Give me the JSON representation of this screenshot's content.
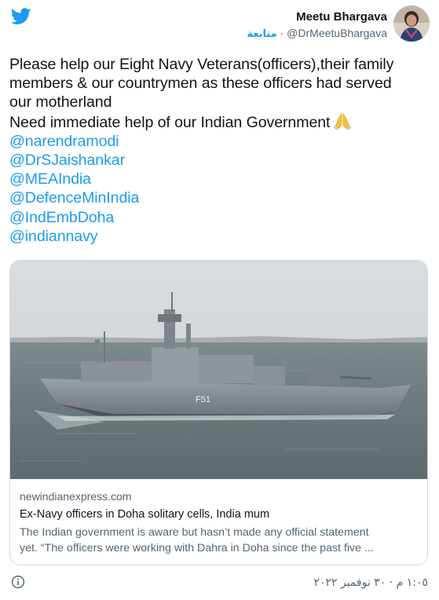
{
  "header": {
    "brand_icon": "twitter-bird-icon",
    "display_name": "Meetu Bhargava",
    "follow_label": "متابعة",
    "separator": "·",
    "handle": "@DrMeetuBhargava",
    "avatar_icon": "profile-avatar"
  },
  "tweet": {
    "lines": [
      "Please help our Eight Navy Veterans(officers),their family",
      "members & our countrymen as these officers had served",
      "our motherland",
      "Need immediate help of our Indian Government"
    ],
    "emoji": "🙏",
    "emoji_icon": "folded-hands-icon",
    "mentions": [
      "@narendramodi",
      "@DrSJaishankar",
      "@MEAIndia",
      "@DefenceMinIndia",
      "@IndEmbDoha",
      "@indiannavy"
    ]
  },
  "card": {
    "image_icon": "navy-frigate-photo",
    "hull_number": "F51",
    "domain": "newindianexpress.com",
    "title": "Ex-Navy officers in Doha solitary cells, India mum",
    "description_lines": [
      "The Indian government is aware but hasn’t made any official statement",
      "yet.  “The officers were working with Dahra in Doha since the past five ..."
    ]
  },
  "footer": {
    "info_icon": "info-circle-icon",
    "timestamp": "١:٠٥ م · ٣٠ نوفمبر ٢٠٢٢"
  },
  "colors": {
    "accent": "#1d9bf0",
    "text": "#0f1419",
    "muted": "#536471",
    "border": "#cfd9de"
  }
}
